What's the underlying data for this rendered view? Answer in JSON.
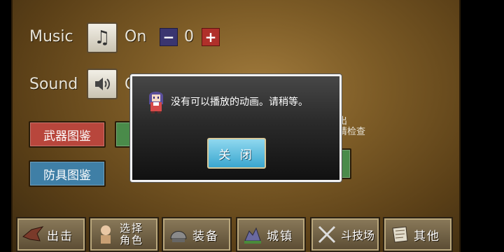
{
  "settings": {
    "music_label": "Music",
    "music_state": "On",
    "music_value": "0",
    "sound_label": "Sound",
    "sound_state_partial": "O"
  },
  "category_buttons": {
    "weapons": "武器图鉴",
    "armor": "防具图鉴"
  },
  "side_note": {
    "line1": "出",
    "line2": "请检查"
  },
  "dialog": {
    "message": "没有可以播放的动画。请稍等。",
    "close_label": "关 闭"
  },
  "nav": {
    "sortie": "出击",
    "select_char_line1": "选择",
    "select_char_line2": "角色",
    "equip": "装备",
    "town": "城镇",
    "arena": "斗技场",
    "other": "其他"
  },
  "icons": {
    "music": "music-note-icon",
    "sound": "speaker-icon",
    "sortie": "bird-icon",
    "select_char": "character-icon",
    "equip": "helmet-icon",
    "town": "town-icon",
    "arena": "swords-icon",
    "other": "scroll-icon"
  },
  "colors": {
    "minus": "#3a3570",
    "plus": "#b0302a",
    "weapons_btn": "#b8463c",
    "armor_btn": "#3f7fa6",
    "close_btn": "#3aa6cf"
  }
}
